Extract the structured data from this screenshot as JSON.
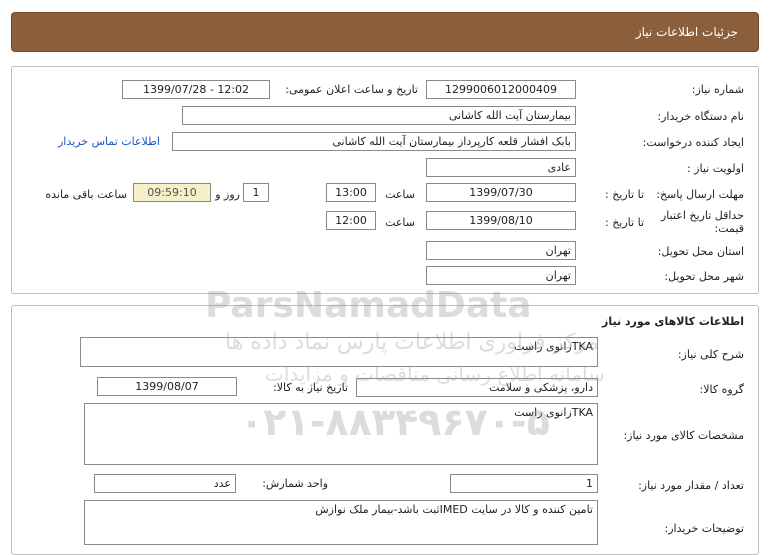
{
  "header": {
    "title": "جزئیات اطلاعات نیاز"
  },
  "need_info": {
    "need_number_label": "شماره نیاز:",
    "need_number": "1299006012000409",
    "announce_label": "تاریخ و ساعت اعلان عمومی:",
    "announce_value": "1399/07/28 - 12:02",
    "buyer_org_label": "نام دستگاه خریدار:",
    "buyer_org": "بیمارستان آیت الله کاشانی",
    "creator_label": "ایجاد کننده درخواست:",
    "creator": "بابک افشار قلعه کارپرداز بیمارستان آیت الله کاشانی",
    "contact_link": "اطلاعات تماس خریدار",
    "priority_label": "اولویت نیاز :",
    "priority": "عادی",
    "deadline_label": "مهلت ارسال پاسخ:",
    "to_date_label": "تا تاریخ :",
    "deadline_date": "1399/07/30",
    "time_label": "ساعت",
    "deadline_time": "13:00",
    "days_value": "1",
    "days_label": "روز و",
    "remaining_time": "09:59:10",
    "remaining_label": "ساعت باقی مانده",
    "validity_label": "حداقل تاریخ اعتبار قیمت:",
    "validity_to_label": "تا تاریخ :",
    "validity_date": "1399/08/10",
    "validity_time_label": "ساعت",
    "validity_time": "12:00",
    "province_label": "استان محل تحویل:",
    "province": "تهران",
    "city_label": "شهر محل تحویل:",
    "city": "تهران"
  },
  "goods": {
    "section_title": "اطلاعات کالاهای مورد نیاز",
    "summary_label": "شرح کلی نیاز:",
    "summary": "TKAزانوی راست",
    "group_label": "گروه کالا:",
    "group": "دارو، پزشکی و سلامت",
    "need_date_label": "تاریخ نیاز به کالا:",
    "need_date": "1399/08/07",
    "spec_label": "مشخصات کالای مورد نیاز:",
    "spec": "TKAزانوی راست",
    "qty_label": "تعداد / مقدار مورد نیاز:",
    "qty": "1",
    "unit_label": "واحد شمارش:",
    "unit": "عدد",
    "buyer_notes_label": "توضیحات خریدار:",
    "buyer_notes": "تامین کننده و کالا در سایت IMEDثبت باشد-بیمار ملک نوازش"
  },
  "watermark": {
    "brand": "ParsNamadData",
    "line1": "مرکز فراوری اطلاعات پارس نماد داده ها",
    "line2": "سامانه اطلاع رسانی مناقصات و مزایدات",
    "phone": "۰۲۱-۸۸۳۴۹۶۷۰-۵"
  }
}
